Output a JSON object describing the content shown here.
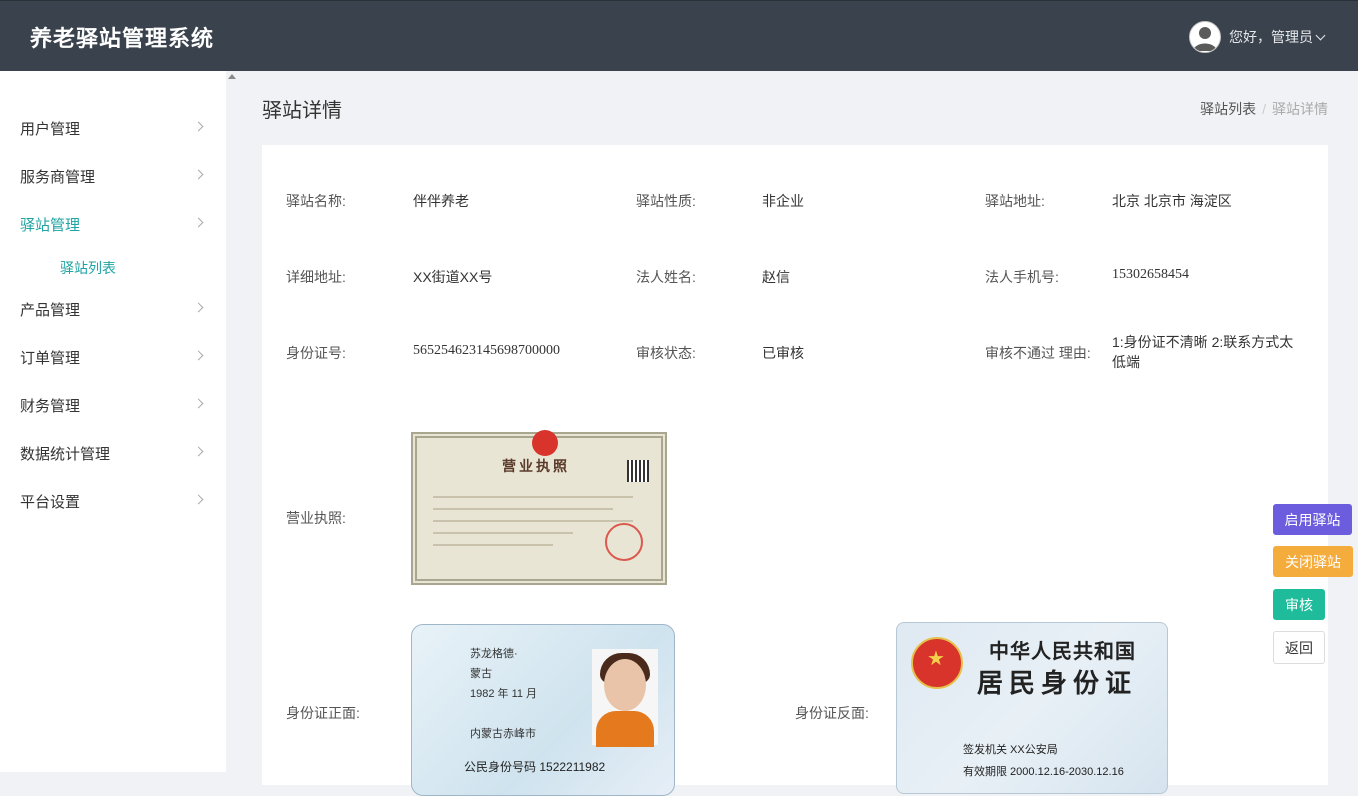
{
  "app": {
    "title": "养老驿站管理系统"
  },
  "header": {
    "greeting": "您好，管理员"
  },
  "sidebar": {
    "items": [
      {
        "label": "用户管理"
      },
      {
        "label": "服务商管理"
      },
      {
        "label": "驿站管理"
      },
      {
        "label": "产品管理"
      },
      {
        "label": "订单管理"
      },
      {
        "label": "财务管理"
      },
      {
        "label": "数据统计管理"
      },
      {
        "label": "平台设置"
      }
    ],
    "subitems": [
      {
        "label": "驿站列表"
      }
    ]
  },
  "page": {
    "title": "驿站详情",
    "breadcrumb": [
      "驿站列表",
      "驿站详情"
    ]
  },
  "details": {
    "name_label": "驿站名称:",
    "name_value": "伴伴养老",
    "nature_label": "驿站性质:",
    "nature_value": "非企业",
    "address_label": "驿站地址:",
    "address_value": "北京 北京市 海淀区",
    "detail_address_label": "详细地址:",
    "detail_address_value": "XX街道XX号",
    "legal_name_label": "法人姓名:",
    "legal_name_value": "赵信",
    "legal_phone_label": "法人手机号:",
    "legal_phone_value": "15302658454",
    "id_number_label": "身份证号:",
    "id_number_value": "565254623145698700000",
    "audit_status_label": "审核状态:",
    "audit_status_value": "已审核",
    "reject_reason_label": "审核不通过 理由:",
    "reject_reason_value": "1:身份证不清晰 2:联系方式太低端",
    "license_label": "营业执照:",
    "id_front_label": "身份证正面:",
    "id_back_label": "身份证反面:"
  },
  "images": {
    "license_title": "营业执照",
    "id_front": {
      "name": "苏龙格德·",
      "ethnic": "蒙古",
      "birth": "1982 年 11 月",
      "address": "内蒙古赤峰市",
      "id_label": "公民身份号码",
      "id_no": "1522211982"
    },
    "id_back": {
      "title1": "中华人民共和国",
      "title2": "居民身份证",
      "issuer": "签发机关  XX公安局",
      "validity": "有效期限  2000.12.16-2030.12.16"
    }
  },
  "actions": {
    "enable": "启用驿站",
    "close": "关闭驿站",
    "audit": "审核",
    "back": "返回"
  },
  "colors": {
    "topbar": "#3a424d",
    "accent": "#1fa3a3",
    "enable": "#6b5ddd",
    "close": "#f4ac3d",
    "audit": "#1fbc9c"
  }
}
